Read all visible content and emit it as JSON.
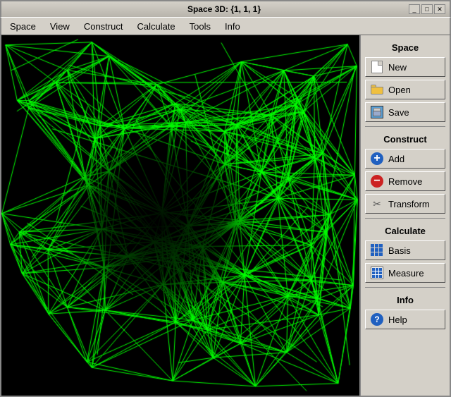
{
  "window": {
    "title": "Space 3D: {1, 1, 1}",
    "minimize_label": "_",
    "maximize_label": "□",
    "close_label": "✕"
  },
  "menu": {
    "items": [
      {
        "label": "Space"
      },
      {
        "label": "View"
      },
      {
        "label": "Construct"
      },
      {
        "label": "Calculate"
      },
      {
        "label": "Tools"
      },
      {
        "label": "Info"
      }
    ]
  },
  "sidebar": {
    "space_label": "Space",
    "new_label": "New",
    "open_label": "Open",
    "save_label": "Save",
    "construct_label": "Construct",
    "add_label": "Add",
    "remove_label": "Remove",
    "transform_label": "Transform",
    "calculate_label": "Calculate",
    "basis_label": "Basis",
    "measure_label": "Measure",
    "info_label": "Info",
    "help_label": "Help"
  },
  "canvas": {
    "background": "#000000",
    "line_color": "#00ff00"
  }
}
